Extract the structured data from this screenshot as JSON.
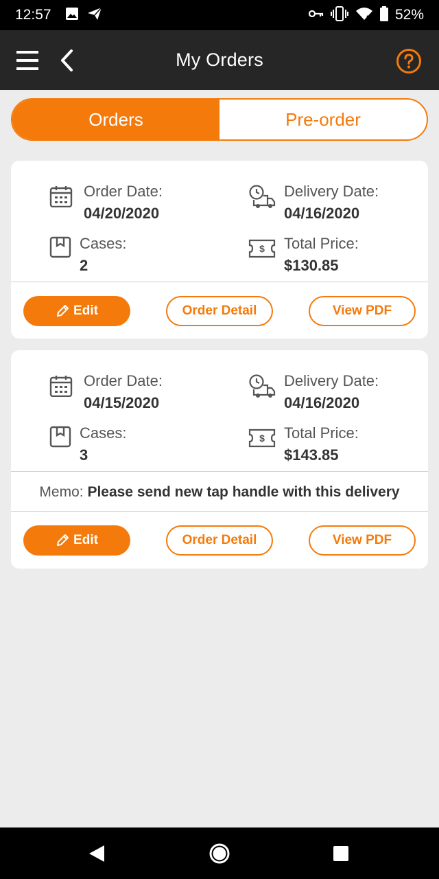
{
  "status_bar": {
    "time": "12:57",
    "battery": "52%",
    "icons": [
      "image-icon",
      "send-icon",
      "key-icon",
      "vibrate-icon",
      "wifi-icon",
      "battery-icon"
    ]
  },
  "app_bar": {
    "title": "My Orders",
    "menu_icon": "hamburger-menu-icon",
    "back_icon": "chevron-left-icon",
    "help_icon": "question-circle-icon"
  },
  "tabs": [
    {
      "label": "Orders",
      "active": true
    },
    {
      "label": "Pre-order",
      "active": false
    }
  ],
  "orders": [
    {
      "order_date_label": "Order Date:",
      "order_date": "04/20/2020",
      "delivery_date_label": "Delivery Date:",
      "delivery_date": "04/16/2020",
      "cases_label": "Cases:",
      "cases": "2",
      "total_price_label": "Total Price:",
      "total_price": "$130.85",
      "memo_label": "",
      "memo": "",
      "buttons": {
        "edit": "Edit",
        "detail": "Order Detail",
        "pdf": "View PDF"
      }
    },
    {
      "order_date_label": "Order Date:",
      "order_date": "04/15/2020",
      "delivery_date_label": "Delivery Date:",
      "delivery_date": "04/16/2020",
      "cases_label": "Cases:",
      "cases": "3",
      "total_price_label": "Total Price:",
      "total_price": "$143.85",
      "memo_label": "Memo:",
      "memo": "Please send new tap handle with this delivery",
      "buttons": {
        "edit": "Edit",
        "detail": "Order Detail",
        "pdf": "View PDF"
      }
    }
  ],
  "colors": {
    "accent": "#f47a0b",
    "app_bar": "#262626",
    "background": "#ececec",
    "card": "#ffffff"
  },
  "nav_bar": {
    "icons": [
      "back-triangle-icon",
      "home-circle-icon",
      "recents-square-icon"
    ]
  }
}
